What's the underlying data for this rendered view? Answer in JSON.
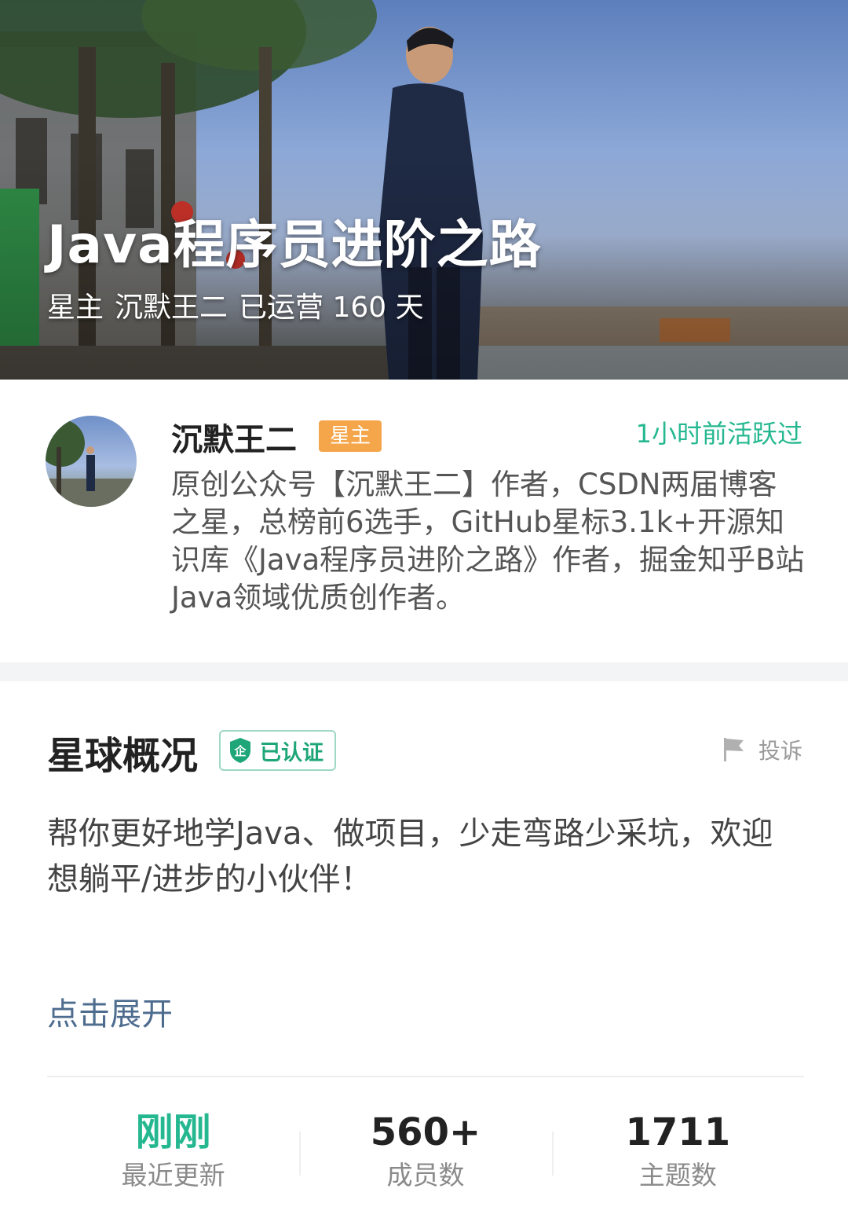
{
  "hero": {
    "title": "Java程序员进阶之路",
    "owner_prefix": "星主",
    "owner_name": "沉默王二",
    "operating": "已运营 160 天"
  },
  "owner": {
    "name": "沉默王二",
    "badge": "星主",
    "active": "1小时前活跃过",
    "bio": "原创公众号【沉默王二】作者，CSDN两届博客之星，总榜前6选手，GitHub星标3.1k+开源知识库《Java程序员进阶之路》作者，掘金知乎B站Java领域优质创作者。"
  },
  "overview": {
    "title": "星球概况",
    "verified": "已认证",
    "verified_icon_text": "企",
    "report": "投诉",
    "description": "帮你更好地学Java、做项目，少走弯路少采坑，欢迎想躺平/进步的小伙伴！",
    "expand": "点击展开"
  },
  "stats": [
    {
      "value": "刚刚",
      "label": "最近更新"
    },
    {
      "value": "560+",
      "label": "成员数"
    },
    {
      "value": "1711",
      "label": "主题数"
    }
  ],
  "colors": {
    "accent_green": "#25b890",
    "badge_orange": "#f5a54a",
    "link_blue": "#4d6c8e"
  },
  "icons": [
    "shield-icon",
    "flag-icon"
  ]
}
